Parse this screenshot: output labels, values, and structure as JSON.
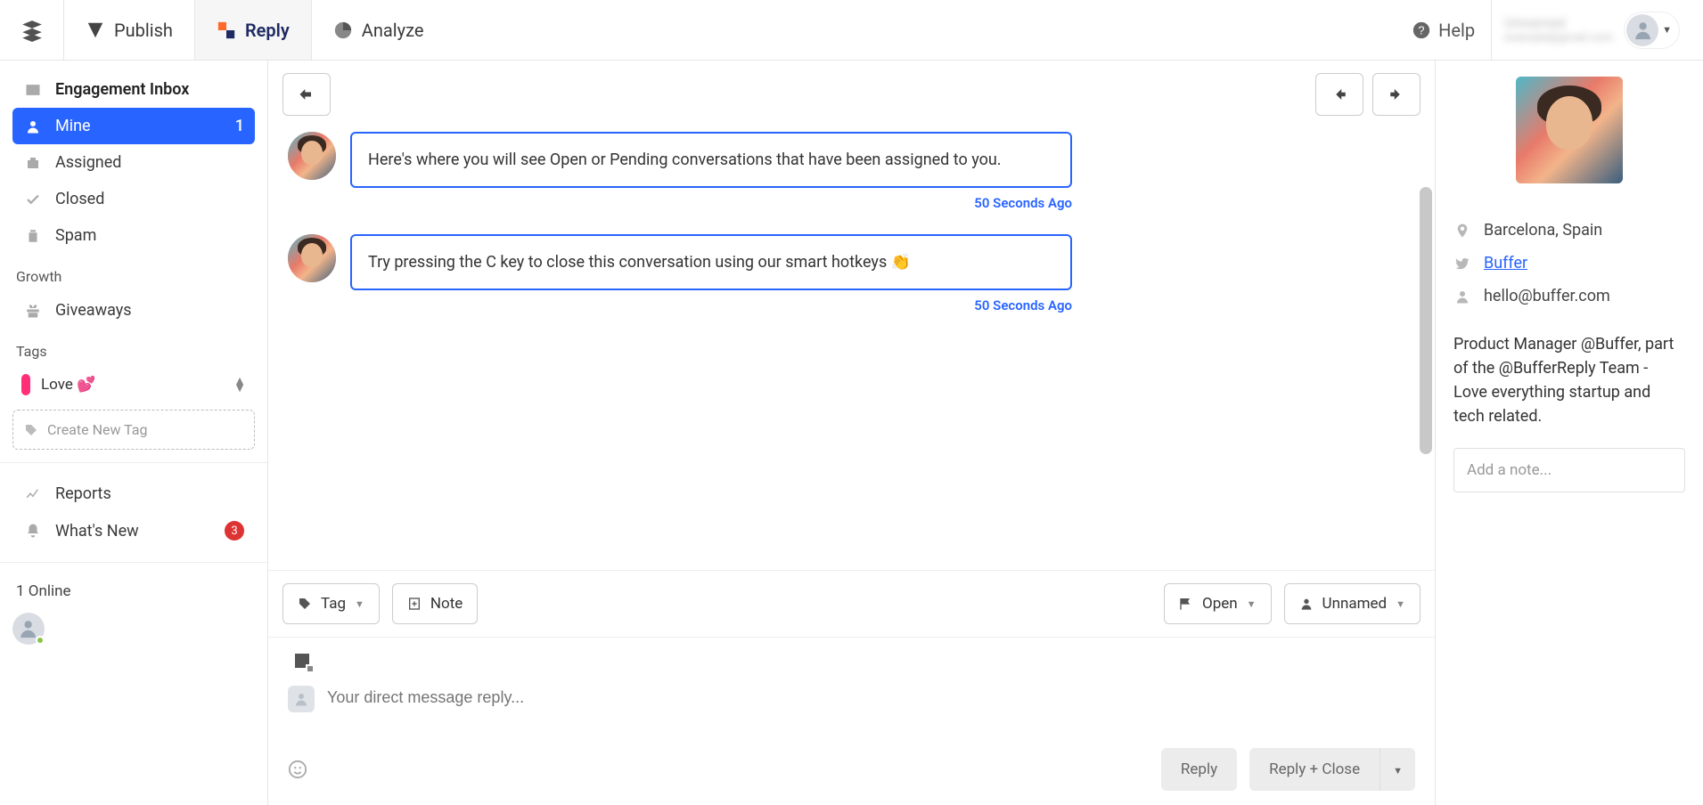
{
  "topnav": {
    "publish": "Publish",
    "reply": "Reply",
    "analyze": "Analyze",
    "help": "Help",
    "user_name": "Unnamed",
    "user_email": "example@gmail.com"
  },
  "sidebar": {
    "inbox_header": "Engagement Inbox",
    "mine": "Mine",
    "mine_count": "1",
    "assigned": "Assigned",
    "closed": "Closed",
    "spam": "Spam",
    "growth_header": "Growth",
    "giveaways": "Giveaways",
    "tags_header": "Tags",
    "tag_love": "Love 💕",
    "create_tag_placeholder": "Create New Tag",
    "reports": "Reports",
    "whatsnew": "What's New",
    "whatsnew_count": "3",
    "online": "1 Online"
  },
  "conversation": {
    "messages": [
      {
        "text": "Here's where you will see Open or Pending conversations that have been assigned to you.",
        "time": "50 Seconds Ago"
      },
      {
        "text": "Try pressing the C key to close this conversation using our smart hotkeys 👏",
        "time": "50 Seconds Ago"
      }
    ]
  },
  "actions": {
    "tag": "Tag",
    "note": "Note",
    "open": "Open",
    "unnamed": "Unnamed"
  },
  "compose": {
    "placeholder": "Your direct message reply...",
    "reply": "Reply",
    "reply_close": "Reply + Close"
  },
  "profile": {
    "location": "Barcelona, Spain",
    "twitter": "Buffer",
    "email": "hello@buffer.com",
    "bio": "Product Manager @Buffer, part of the @BufferReply Team - Love everything startup and tech related.",
    "note_placeholder": "Add a note..."
  }
}
